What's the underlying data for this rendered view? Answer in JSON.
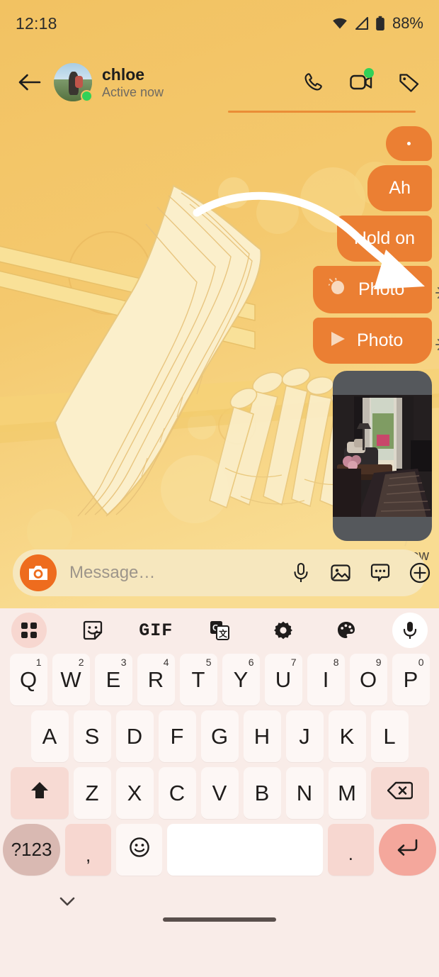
{
  "status_bar": {
    "time": "12:18",
    "battery_percent": "88%",
    "icons": [
      "wifi-icon",
      "cellular-signal-icon",
      "battery-icon"
    ]
  },
  "chat_header": {
    "back_icon": "back-arrow-icon",
    "peer_name": "chloe",
    "peer_status": "Active now",
    "presence": "online",
    "actions": [
      {
        "name": "voice-call-button",
        "icon": "phone-icon",
        "badge": false
      },
      {
        "name": "video-call-button",
        "icon": "video-camera-icon",
        "badge": true
      },
      {
        "name": "tag-button",
        "icon": "tag-icon",
        "badge": false
      }
    ]
  },
  "conversation": {
    "messages": [
      {
        "id": "m1",
        "type": "text",
        "text": "·",
        "outgoing": true,
        "pending": false
      },
      {
        "id": "m2",
        "type": "text",
        "text": "Ah",
        "outgoing": true,
        "pending": false
      },
      {
        "id": "m3",
        "type": "text",
        "text": "Hold on",
        "outgoing": true,
        "pending": false
      },
      {
        "id": "m4",
        "type": "attachment",
        "label": "Photo",
        "icon": "camera-flash-icon",
        "outgoing": true,
        "pending": true
      },
      {
        "id": "m5",
        "type": "attachment",
        "label": "Photo",
        "icon": "play-icon",
        "outgoing": true,
        "pending": true
      }
    ],
    "attachment_preview": {
      "name": "photo-thumbnail",
      "alt": "living room with curtains, sofa and coffee table"
    },
    "receipt": "Seen just now"
  },
  "composer": {
    "camera_icon": "camera-icon",
    "input_value": "",
    "placeholder": "Message…",
    "actions": [
      {
        "name": "voice-message-button",
        "icon": "microphone-icon"
      },
      {
        "name": "gallery-button",
        "icon": "image-icon"
      },
      {
        "name": "sticker-button",
        "icon": "speech-bubble-icon"
      },
      {
        "name": "more-options-button",
        "icon": "plus-circle-icon"
      }
    ]
  },
  "keyboard": {
    "toolbar": [
      {
        "name": "clipboard-grid-button",
        "icon": "grid-icon",
        "active": true
      },
      {
        "name": "sticker-button",
        "icon": "sticker-smiley-icon",
        "active": false
      },
      {
        "name": "gif-button",
        "icon": "gif-icon",
        "label": "GIF",
        "active": false
      },
      {
        "name": "translate-button",
        "icon": "google-translate-icon",
        "active": false
      },
      {
        "name": "settings-button",
        "icon": "gear-icon",
        "active": false
      },
      {
        "name": "theme-button",
        "icon": "palette-icon",
        "active": false
      },
      {
        "name": "voice-input-button",
        "icon": "microphone-icon",
        "active": false
      }
    ],
    "row1": [
      {
        "key": "Q",
        "sup": "1"
      },
      {
        "key": "W",
        "sup": "2"
      },
      {
        "key": "E",
        "sup": "3"
      },
      {
        "key": "R",
        "sup": "4"
      },
      {
        "key": "T",
        "sup": "5"
      },
      {
        "key": "Y",
        "sup": "6"
      },
      {
        "key": "U",
        "sup": "7"
      },
      {
        "key": "I",
        "sup": "8"
      },
      {
        "key": "O",
        "sup": "9"
      },
      {
        "key": "P",
        "sup": "0"
      }
    ],
    "row2": [
      {
        "key": "A"
      },
      {
        "key": "S"
      },
      {
        "key": "D"
      },
      {
        "key": "F"
      },
      {
        "key": "G"
      },
      {
        "key": "H"
      },
      {
        "key": "J"
      },
      {
        "key": "K"
      },
      {
        "key": "L"
      }
    ],
    "row3": [
      {
        "key": "Z"
      },
      {
        "key": "X"
      },
      {
        "key": "C"
      },
      {
        "key": "V"
      },
      {
        "key": "B"
      },
      {
        "key": "N"
      },
      {
        "key": "M"
      }
    ],
    "shift_icon": "shift-up-arrow-icon",
    "backspace_icon": "backspace-delete-icon",
    "row4": {
      "symbols_label": "?123",
      "comma_label": ",",
      "emoji_icon": "emoji-smiley-icon",
      "space_label": "",
      "period_label": ".",
      "enter_icon": "enter-return-icon"
    }
  },
  "system_nav": {
    "hide_keyboard_icon": "chevron-down-icon",
    "home_indicator": "home-gesture-pill"
  },
  "colors": {
    "wallpaper_top": "#F2C262",
    "wallpaper_bottom": "#F8D98E",
    "bubble_outgoing": "#EB7F33",
    "accent_orange": "#EE6C1E",
    "presence_green": "#31D158",
    "keyboard_bg": "#F9ECE8",
    "key_bg": "#FDF7F5",
    "key_fn_bg": "#F7DAD3",
    "enter_key_bg": "#F4A79C",
    "symbols_key_bg": "#D9B9B2",
    "composer_bg": "#F6E7BE"
  }
}
